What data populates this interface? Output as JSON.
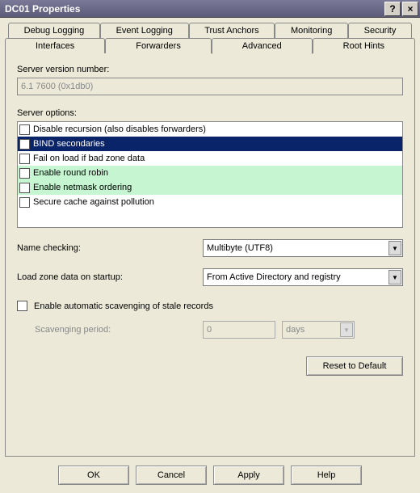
{
  "titlebar": {
    "title": "DC01 Properties",
    "help": "?",
    "close": "×"
  },
  "tabs_back": [
    {
      "label": "Debug Logging"
    },
    {
      "label": "Event Logging"
    },
    {
      "label": "Trust Anchors"
    },
    {
      "label": "Monitoring"
    },
    {
      "label": "Security"
    }
  ],
  "tabs_front": [
    {
      "label": "Interfaces"
    },
    {
      "label": "Forwarders"
    },
    {
      "label": "Advanced"
    },
    {
      "label": "Root Hints"
    }
  ],
  "panel": {
    "version_label": "Server version number:",
    "version_value": "6.1 7600 (0x1db0)",
    "options_label": "Server options:",
    "options": [
      {
        "label": "Disable recursion (also disables forwarders)",
        "checked": false,
        "selected": false,
        "green": false
      },
      {
        "label": "BIND secondaries",
        "checked": false,
        "selected": true,
        "green": false
      },
      {
        "label": "Fail on load if bad zone data",
        "checked": false,
        "selected": false,
        "green": false
      },
      {
        "label": "Enable round robin",
        "checked": false,
        "selected": false,
        "green": true
      },
      {
        "label": "Enable netmask ordering",
        "checked": false,
        "selected": false,
        "green": true
      },
      {
        "label": "Secure cache against pollution",
        "checked": false,
        "selected": false,
        "green": false
      }
    ],
    "name_checking_label": "Name checking:",
    "name_checking_value": "Multibyte (UTF8)",
    "load_zone_label": "Load zone data on startup:",
    "load_zone_value": "From Active Directory and registry",
    "scavenging_checkbox": "Enable automatic scavenging of stale records",
    "scavenging_period_label": "Scavenging period:",
    "scavenging_period_value": "0",
    "scavenging_period_unit": "days",
    "reset_button": "Reset to Default"
  },
  "buttons": {
    "ok": "OK",
    "cancel": "Cancel",
    "apply": "Apply",
    "help": "Help"
  }
}
